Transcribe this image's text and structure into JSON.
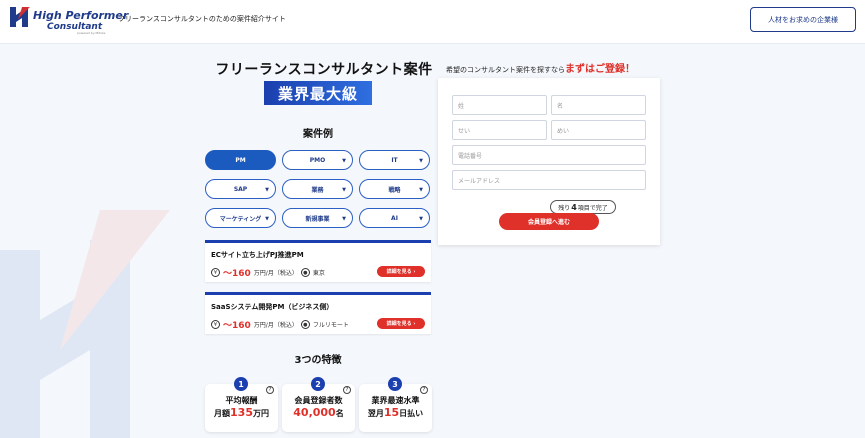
{
  "header": {
    "logo_line1": "High Performer",
    "logo_line2": "Consultant",
    "logo_line3": "powered by Mitoke",
    "tagline": "フリーランスコンサルタントのための案件紹介サイト",
    "corporate_button": "人材をお求めの企業様"
  },
  "hero": {
    "title": "フリーランスコンサルタント案件",
    "badge": "業界最大級"
  },
  "categories": {
    "title": "案件例",
    "items": [
      {
        "label": "PM",
        "active": true,
        "has_caret": false
      },
      {
        "label": "PMO",
        "active": false,
        "has_caret": true
      },
      {
        "label": "IT",
        "active": false,
        "has_caret": true
      },
      {
        "label": "SAP",
        "active": false,
        "has_caret": true
      },
      {
        "label": "業務",
        "active": false,
        "has_caret": true
      },
      {
        "label": "戦略",
        "active": false,
        "has_caret": true
      },
      {
        "label": "マーケティング",
        "active": false,
        "has_caret": true
      },
      {
        "label": "新規事業",
        "active": false,
        "has_caret": true
      },
      {
        "label": "AI",
        "active": false,
        "has_caret": true
      }
    ]
  },
  "jobs": [
    {
      "title": "ECサイト立ち上げPJ推進PM",
      "yen_icon": "¥",
      "salary": "〜160",
      "salary_unit": "万円/月（税込）",
      "location": "東京",
      "detail": "詳細を見る ›"
    },
    {
      "title": "SaaSシステム開発PM（ビジネス側）",
      "yen_icon": "¥",
      "salary": "〜160",
      "salary_unit": "万円/月（税込）",
      "location": "フルリモート",
      "detail": "詳細を見る ›"
    }
  ],
  "features": {
    "title": "3つの特徴",
    "items": [
      {
        "num": "1",
        "line1": "平均報酬",
        "pre": "月額",
        "value": "135",
        "post": "万円"
      },
      {
        "num": "2",
        "line1": "会員登録者数",
        "pre": "",
        "value": "40,000",
        "post": "名"
      },
      {
        "num": "3",
        "line1": "業界最速水準",
        "pre": "翌月",
        "value": "15",
        "post": "日払い"
      }
    ]
  },
  "form": {
    "heading": "希望のコンサルタント案件を探すなら",
    "heading_em": "まずはご登録！",
    "placeholders": {
      "last_name": "姓",
      "first_name": "名",
      "last_kana": "せい",
      "first_kana": "めい",
      "phone": "電話番号",
      "email": "メールアドレス"
    },
    "remaining_pre": "残り",
    "remaining_num": "4",
    "remaining_post": "項目で完了",
    "submit": "会員登録へ進む"
  },
  "colors": {
    "primary": "#1b3fae",
    "accent_red": "#e0302a",
    "background": "#f4f7fb"
  }
}
